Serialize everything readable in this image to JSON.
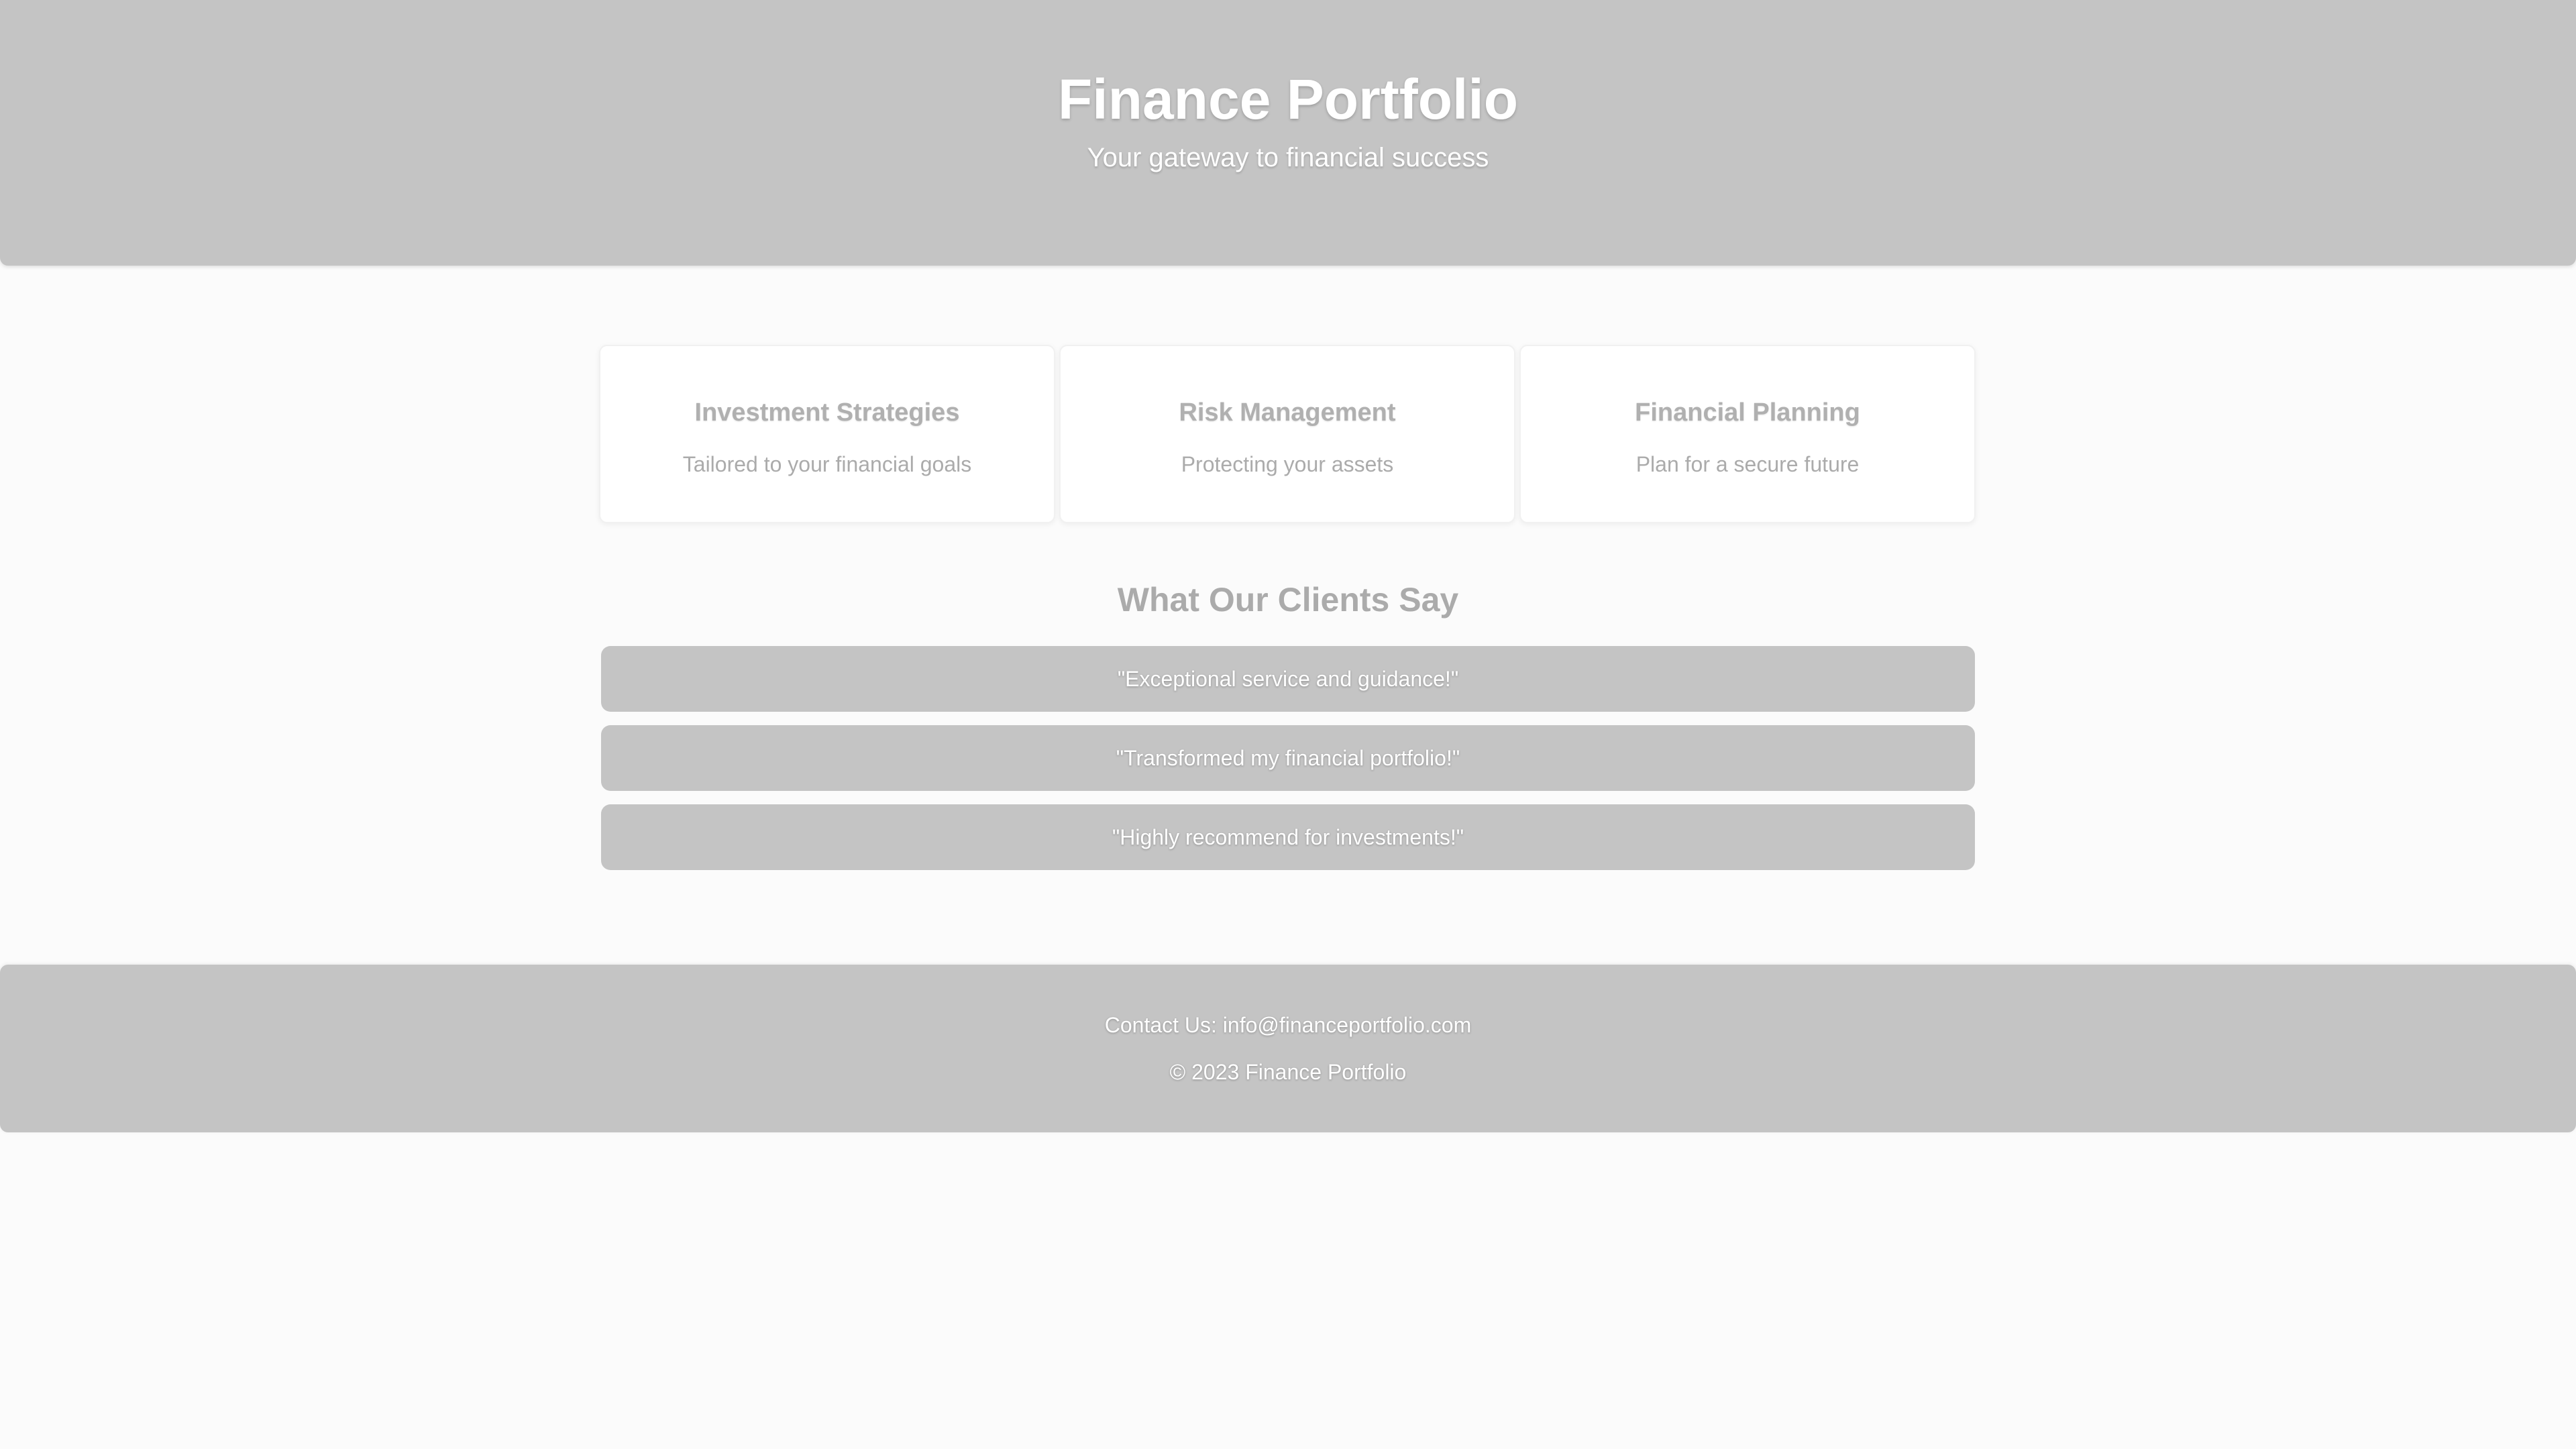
{
  "header": {
    "title": "Finance Portfolio",
    "subtitle": "Your gateway to financial success"
  },
  "services": [
    {
      "title": "Investment Strategies",
      "description": "Tailored to your financial goals"
    },
    {
      "title": "Risk Management",
      "description": "Protecting your assets"
    },
    {
      "title": "Financial Planning",
      "description": "Plan for a secure future"
    }
  ],
  "testimonials": {
    "heading": "What Our Clients Say",
    "items": [
      "\"Exceptional service and guidance!\"",
      "\"Transformed my financial portfolio!\"",
      "\"Highly recommend for investments!\""
    ]
  },
  "footer": {
    "contact": "Contact Us: info@financeportfolio.com",
    "copyright": "© 2023 Finance Portfolio"
  },
  "colors": {
    "panel": "#c4c4c4",
    "background": "#fbfbfb",
    "card": "#ffffff",
    "muted_text": "#ababab"
  }
}
